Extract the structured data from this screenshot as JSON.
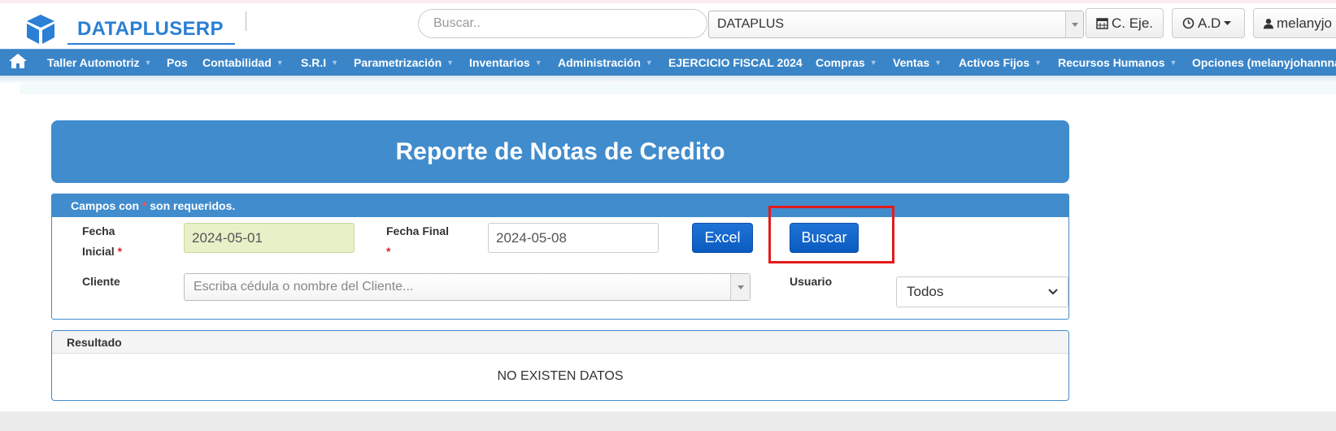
{
  "header": {
    "brand_name": "DATAPLUSERP",
    "search_placeholder": "Buscar..",
    "company_value": "DATAPLUS",
    "period_button": "C. Eje.",
    "ad_button": "A.D",
    "user_button": "melanyjo"
  },
  "menu": {
    "items": [
      {
        "label": "Taller Automotriz"
      },
      {
        "label": "Pos"
      },
      {
        "label": "Contabilidad"
      },
      {
        "label": "S.R.I"
      },
      {
        "label": "Parametrización"
      },
      {
        "label": "Inventarios"
      },
      {
        "label": "Administración"
      },
      {
        "label": "EJERCICIO FISCAL 2024"
      },
      {
        "label": "Compras"
      },
      {
        "label": "Ventas"
      },
      {
        "label": "Activos Fijos"
      },
      {
        "label": "Recursos Humanos"
      },
      {
        "label": "Opciones (melanyjohannna"
      }
    ]
  },
  "page": {
    "title": "Reporte de Notas de Credito"
  },
  "form": {
    "note_prefix": "Campos con ",
    "note_star": "*",
    "note_suffix": " son requeridos.",
    "fecha_inicial_label_1": "Fecha",
    "fecha_inicial_label_2": "Inicial",
    "required_star": "*",
    "fecha_inicial_value": "2024-05-01",
    "fecha_final_label": "Fecha Final",
    "fecha_final_value": "2024-05-08",
    "excel_button": "Excel",
    "buscar_button": "Buscar",
    "cliente_label": "Cliente",
    "cliente_placeholder": "Escriba cédula o nombre del Cliente...",
    "usuario_label": "Usuario",
    "usuario_value": "Todos"
  },
  "result": {
    "header": "Resultado",
    "empty_message": "NO EXISTEN DATOS"
  },
  "colors": {
    "brand": "#2b7fd4",
    "menu_bg": "#3a85c8",
    "panel_blue": "#418ccd",
    "highlight_box": "#e31b1b",
    "button_blue": "#0a5bc0"
  }
}
